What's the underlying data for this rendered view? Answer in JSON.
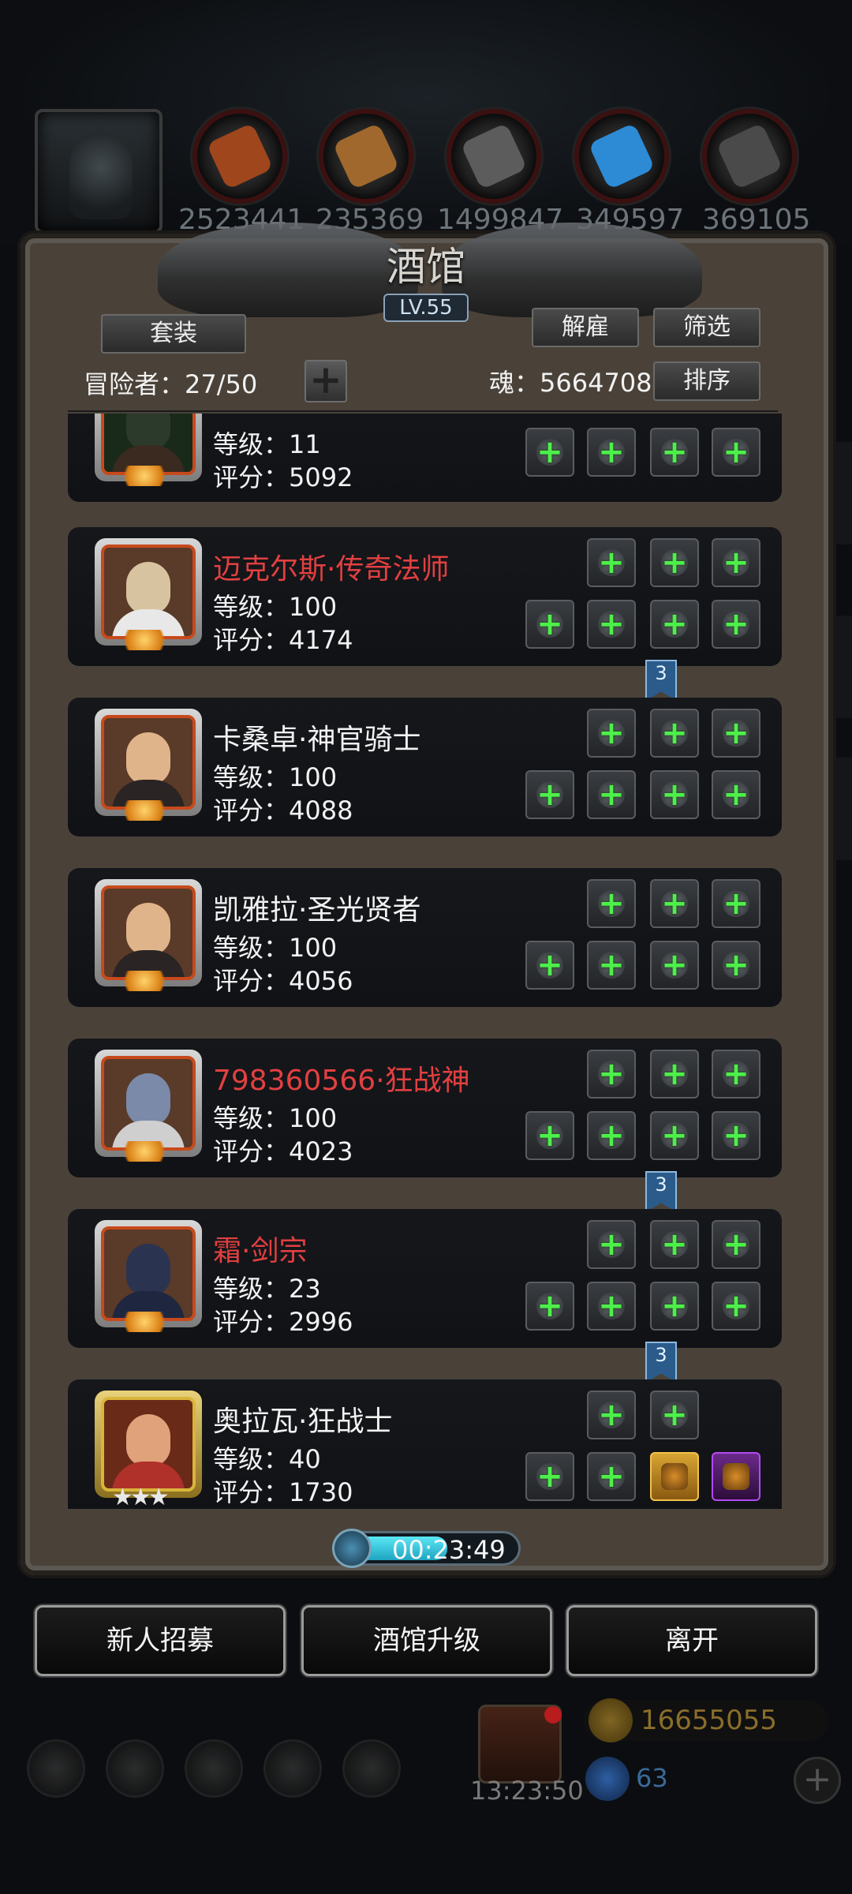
{
  "resources": [
    {
      "icon": "meat-icon",
      "value": "2523441",
      "color": "#a0461c"
    },
    {
      "icon": "wood-icon",
      "value": "235369",
      "color": "#a0682c"
    },
    {
      "icon": "stone-icon",
      "value": "1499847",
      "color": "#5c5c5c"
    },
    {
      "icon": "crystal-icon",
      "value": "349597",
      "color": "#2d8bd6"
    },
    {
      "icon": "iron-icon",
      "value": "369105",
      "color": "#4a4a4a"
    }
  ],
  "tavern": {
    "title": "酒馆",
    "level": "LV.55",
    "set_label": "套装",
    "dismiss_label": "解雇",
    "filter_label": "筛选",
    "sort_label": "排序",
    "adventurer_label": "冒险者：27/50",
    "soul_label": "魂：5664708"
  },
  "heroes": [
    {
      "name": "",
      "level": "等级：11",
      "score": "评分：5092",
      "name_color": "white"
    },
    {
      "name": "迈克尔斯·传奇法师",
      "level": "等级：100",
      "score": "评分：4174",
      "name_color": "red"
    },
    {
      "name": "卡桑卓·神官骑士",
      "level": "等级：100",
      "score": "评分：4088",
      "name_color": "white"
    },
    {
      "name": "凯雅拉·圣光贤者",
      "level": "等级：100",
      "score": "评分：4056",
      "name_color": "white"
    },
    {
      "name": "798360566·狂战神",
      "level": "等级：100",
      "score": "评分：4023",
      "name_color": "red"
    },
    {
      "name": "霜·剑宗",
      "level": "等级：23",
      "score": "评分：2996",
      "name_color": "red"
    },
    {
      "name": "奥拉瓦·狂战士",
      "level": "等级：40",
      "score": "评分：1730",
      "name_color": "white"
    }
  ],
  "badges": [
    "3",
    "3",
    "3"
  ],
  "timer": "00:23:49",
  "actions": {
    "recruit": "新人招募",
    "upgrade": "酒馆升级",
    "leave": "离开"
  },
  "footer": {
    "gift_timer": "13:23:50",
    "gold": "16655055",
    "gems": "63"
  }
}
